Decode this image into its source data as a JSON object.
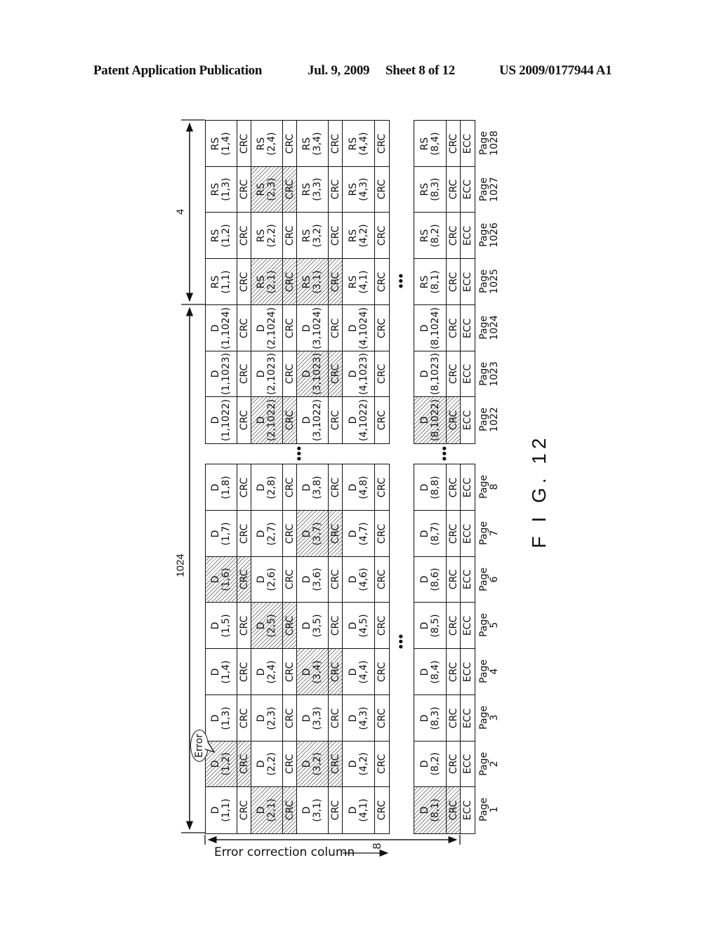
{
  "header": {
    "publication": "Patent Application Publication",
    "date": "Jul. 9, 2009",
    "sheet": "Sheet 8 of 12",
    "number": "US 2009/0177944 A1"
  },
  "figure": {
    "label": "F I G. 12",
    "dimension_upper": "4",
    "dimension_lower": "1024",
    "axis_label": "Error correction column",
    "axis_count": "8",
    "error_label": "Error",
    "ellipsis": "•••",
    "columns": [
      1,
      2,
      3,
      4,
      8
    ],
    "upper_section": {
      "pages": [
        {
          "page": "Page\n1028",
          "kind": "RS",
          "idx": "4",
          "hatched": []
        },
        {
          "page": "Page\n1027",
          "kind": "RS",
          "idx": "3",
          "hatched": [
            2
          ]
        },
        {
          "page": "Page\n1026",
          "kind": "RS",
          "idx": "2",
          "hatched": []
        },
        {
          "page": "Page\n1025",
          "kind": "RS",
          "idx": "1",
          "hatched": [
            2,
            3
          ]
        },
        {
          "page": "Page\n1024",
          "kind": "D",
          "idx": "1024",
          "hatched": []
        },
        {
          "page": "Page\n1023",
          "kind": "D",
          "idx": "1023",
          "hatched": [
            3
          ]
        },
        {
          "page": "Page\n1022",
          "kind": "D",
          "idx": "1022",
          "hatched": [
            2,
            8
          ]
        }
      ]
    },
    "lower_section": {
      "pages": [
        {
          "page": "Page\n8",
          "kind": "D",
          "idx": "8",
          "hatched": []
        },
        {
          "page": "Page\n7",
          "kind": "D",
          "idx": "7",
          "hatched": [
            3
          ]
        },
        {
          "page": "Page\n6",
          "kind": "D",
          "idx": "6",
          "hatched": [
            1
          ]
        },
        {
          "page": "Page\n5",
          "kind": "D",
          "idx": "5",
          "hatched": [
            2
          ]
        },
        {
          "page": "Page\n4",
          "kind": "D",
          "idx": "4",
          "hatched": [
            3
          ]
        },
        {
          "page": "Page\n3",
          "kind": "D",
          "idx": "3",
          "hatched": []
        },
        {
          "page": "Page\n2",
          "kind": "D",
          "idx": "2",
          "hatched": [
            1,
            3
          ]
        },
        {
          "page": "Page\n1",
          "kind": "D",
          "idx": "1",
          "hatched": [
            2,
            8
          ]
        }
      ]
    },
    "crc_label": "CRC",
    "ecc_label": "ECC"
  }
}
